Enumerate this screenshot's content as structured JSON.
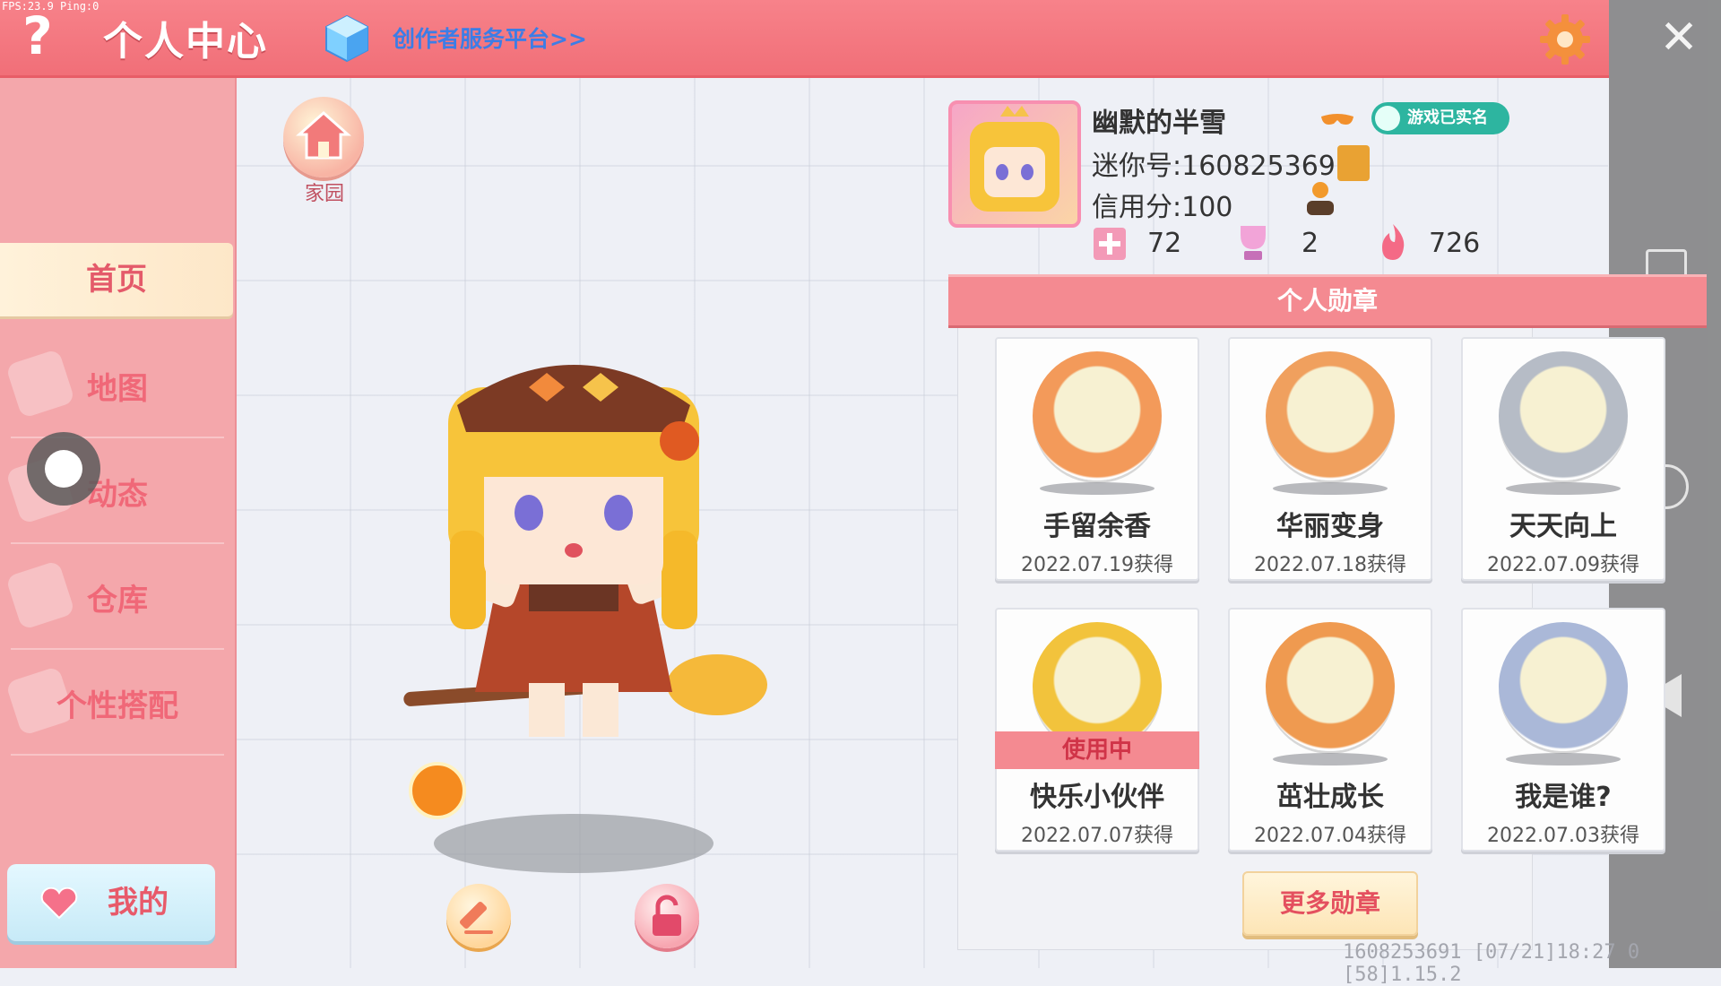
{
  "debug": {
    "fps_text": "FPS:23.9 Ping:0"
  },
  "header": {
    "help_symbol": "?",
    "title": "个人中心",
    "creator_link": "创作者服务平台>>",
    "close_symbol": "✕"
  },
  "sidebar": {
    "items": [
      {
        "label": "首页",
        "active": true
      },
      {
        "label": "地图"
      },
      {
        "label": "动态"
      },
      {
        "label": "仓库"
      },
      {
        "label": "个性搭配"
      }
    ],
    "mine_label": "我的"
  },
  "center": {
    "home_label": "家园"
  },
  "profile": {
    "name": "幽默的半雪",
    "verified_label": "游戏已实名",
    "mini_id": "迷你号:1608253691",
    "credit": "信用分:100",
    "stats": [
      {
        "icon": "plus-ticket-icon",
        "value": "72"
      },
      {
        "icon": "trophy-icon",
        "value": "2"
      },
      {
        "icon": "flame-icon",
        "value": "726"
      }
    ]
  },
  "medals": {
    "title": "个人勋章",
    "items": [
      {
        "name": "手留余香",
        "date": "2022.07.19获得",
        "icon": "frog-medal-icon",
        "color": "#f39a5a"
      },
      {
        "name": "华丽变身",
        "date": "2022.07.18获得",
        "icon": "dino-medal-icon",
        "color": "#f0a05e"
      },
      {
        "name": "天天向上",
        "date": "2022.07.09获得",
        "icon": "calendar-medal-icon",
        "color": "#b6bcc6"
      },
      {
        "name": "快乐小伙伴",
        "date": "2022.07.07获得",
        "icon": "friends-medal-icon",
        "color": "#f2c33c",
        "status": "使用中"
      },
      {
        "name": "茁壮成长",
        "date": "2022.07.04获得",
        "icon": "king-frog-medal-icon",
        "color": "#ef9a50"
      },
      {
        "name": "我是谁?",
        "date": "2022.07.03获得",
        "icon": "letter-medal-icon",
        "color": "#aab8d8"
      }
    ],
    "more_label": "更多勋章"
  },
  "footer": {
    "info": "1608253691   [07/21]18:27 0  [58]1.15.2"
  }
}
